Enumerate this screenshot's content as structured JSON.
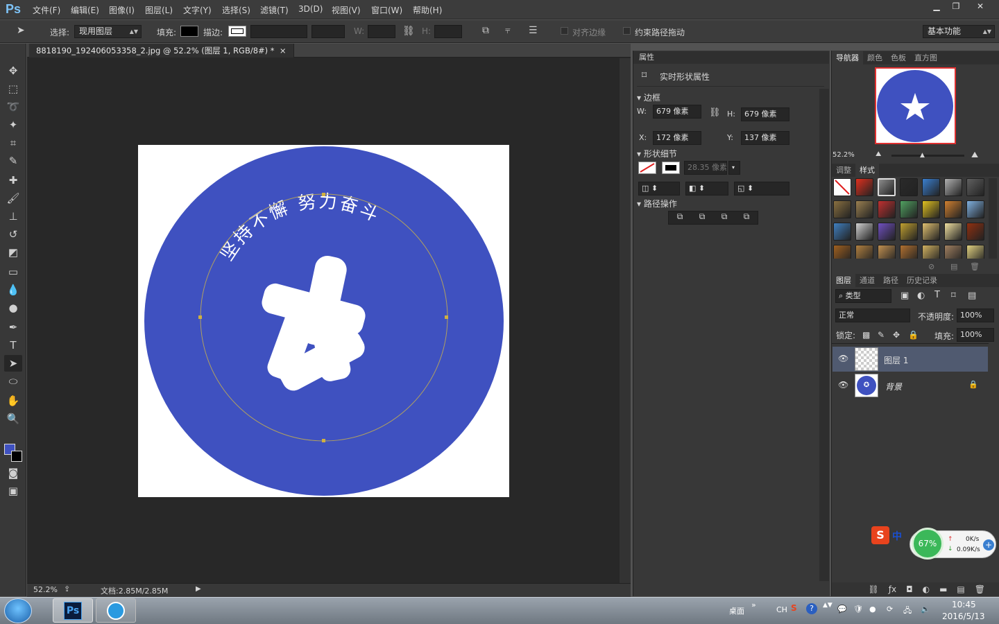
{
  "app": {
    "logo": "Ps"
  },
  "menu": [
    "文件(F)",
    "编辑(E)",
    "图像(I)",
    "图层(L)",
    "文字(Y)",
    "选择(S)",
    "滤镜(T)",
    "3D(D)",
    "视图(V)",
    "窗口(W)",
    "帮助(H)"
  ],
  "window_controls": {
    "minimize": "▁",
    "restore": "❐",
    "close": "✕"
  },
  "options": {
    "select_label": "选择:",
    "select_value": "现用图层",
    "fill_label": "填充:",
    "stroke_label": "描边:",
    "w_label": "W:",
    "h_label": "H:",
    "align_edges": "对齐边缘",
    "constrain_path": "约束路径拖动",
    "workspace": "基本功能"
  },
  "document": {
    "tab_title": "8818190_192406053358_2.jpg @ 52.2% (图层 1, RGB/8#) *",
    "tab_close": "×",
    "canvas_text": "坚持不懈  努力奋斗",
    "circle_color": "#3f51c0",
    "zoom": "52.2%",
    "doc_size": "文档:2.85M/2.85M"
  },
  "properties": {
    "tab": "属性",
    "title": "实时形状属性",
    "section_bbox": "边框",
    "w_label": "W:",
    "w_value": "679 像素",
    "h_label": "H:",
    "h_value": "679 像素",
    "x_label": "X:",
    "x_value": "172 像素",
    "y_label": "Y:",
    "y_value": "137 像素",
    "section_shape": "形状细节",
    "stroke_width": "28.35 像素",
    "section_path": "路径操作"
  },
  "navigator": {
    "tabs": [
      "导航器",
      "颜色",
      "色板",
      "直方图"
    ],
    "zoom": "52.2%"
  },
  "styles": {
    "tabs": [
      "调整",
      "样式"
    ],
    "swatch_colors": [
      "#ffffff",
      "#e0301e",
      "#8c8c8c",
      "#2a2a2a",
      "#3a7fd0",
      "#b0b0b0",
      "#606060",
      "#8a7040",
      "#9a8050",
      "#c03030",
      "#50a060",
      "#e0c020",
      "#d08030",
      "#80b0e0",
      "#4080c0",
      "#d0d0d0",
      "#7050c0",
      "#c0a030",
      "#e0c070",
      "#f0e0a0",
      "#903010",
      "#a06020",
      "#b08040",
      "#c09050",
      "#b07030",
      "#d0b060",
      "#a08060",
      "#e0d080"
    ]
  },
  "layers": {
    "tabs": [
      "图层",
      "通道",
      "路径",
      "历史记录"
    ],
    "filter": "类型",
    "blend_mode": "正常",
    "opacity_label": "不透明度:",
    "opacity": "100%",
    "lock_label": "锁定:",
    "fill_label": "填充:",
    "fill": "100%",
    "items": [
      {
        "name": "图层 1"
      },
      {
        "name": "背景"
      }
    ]
  },
  "widget": {
    "ime": "中",
    "percent": "67%",
    "up": "0K/s",
    "down": "0.09K/s"
  },
  "taskbar": {
    "desktop": "桌面",
    "lang": "CH",
    "time": "10:45",
    "date": "2016/5/13"
  }
}
